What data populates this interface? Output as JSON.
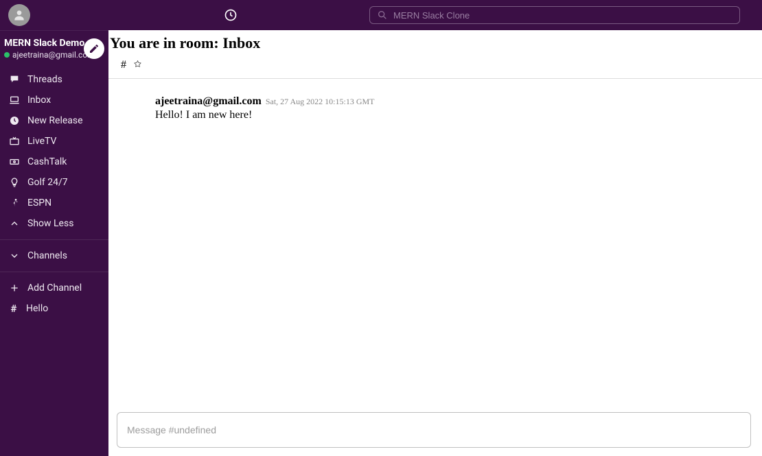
{
  "search_placeholder": "MERN Slack Clone",
  "workspace": {
    "title": "MERN Slack Demo",
    "user_email": "ajeetraina@gmail.com"
  },
  "sidebar": {
    "items": [
      {
        "label": "Threads",
        "icon": "thread"
      },
      {
        "label": "Inbox",
        "icon": "laptop"
      },
      {
        "label": "New Release",
        "icon": "clock-fill"
      },
      {
        "label": "LiveTV",
        "icon": "tv"
      },
      {
        "label": "CashTalk",
        "icon": "cash"
      },
      {
        "label": "Golf 24/7",
        "icon": "bulb"
      },
      {
        "label": "ESPN",
        "icon": "run"
      }
    ],
    "show_less": "Show Less",
    "channels_label": "Channels",
    "add_channel": "Add Channel",
    "channel_list": [
      {
        "label": "Hello"
      }
    ]
  },
  "room": {
    "title_prefix": "You are in room: ",
    "name": "Inbox",
    "hash": "#"
  },
  "messages": [
    {
      "user": "ajeetraina@gmail.com",
      "timestamp": "Sat, 27 Aug 2022 10:15:13 GMT",
      "text": "Hello! I am new here!"
    }
  ],
  "composer": {
    "placeholder": "Message #undefined"
  }
}
